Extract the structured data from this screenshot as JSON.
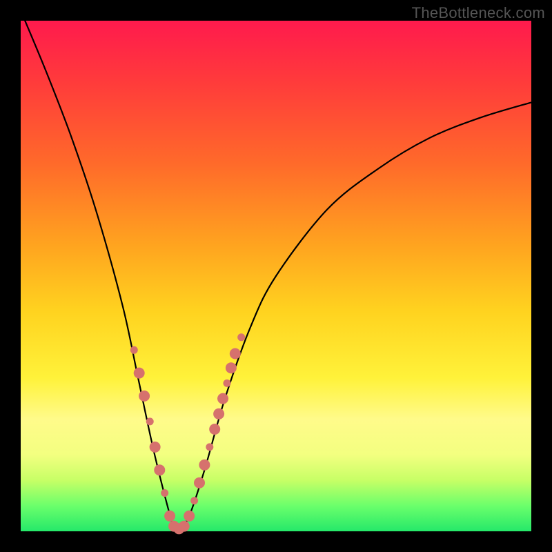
{
  "watermark": "TheBottleneck.com",
  "chart_data": {
    "type": "line",
    "title": "",
    "xlabel": "",
    "ylabel": "",
    "xlim": [
      0,
      100
    ],
    "ylim": [
      0,
      100
    ],
    "series": [
      {
        "name": "bottleneck-curve",
        "x": [
          0,
          5,
          10,
          15,
          20,
          23,
          26,
          29,
          30,
          31,
          33,
          36,
          40,
          45,
          50,
          60,
          70,
          80,
          90,
          100
        ],
        "values": [
          102,
          90,
          77,
          62,
          44,
          30,
          16,
          4,
          1,
          0.5,
          3,
          12,
          26,
          40,
          50,
          63,
          71,
          77,
          81,
          84
        ]
      }
    ],
    "markers": {
      "name": "highlight-points",
      "color": "#d6716d",
      "radius_small": 5.5,
      "radius_large": 8,
      "points": [
        {
          "x": 22.2,
          "y": 35.5,
          "r": "small"
        },
        {
          "x": 23.2,
          "y": 31.0,
          "r": "large"
        },
        {
          "x": 24.2,
          "y": 26.5,
          "r": "large"
        },
        {
          "x": 25.3,
          "y": 21.5,
          "r": "small"
        },
        {
          "x": 26.3,
          "y": 16.5,
          "r": "large"
        },
        {
          "x": 27.2,
          "y": 12.0,
          "r": "large"
        },
        {
          "x": 28.2,
          "y": 7.5,
          "r": "small"
        },
        {
          "x": 29.2,
          "y": 3.0,
          "r": "large"
        },
        {
          "x": 30.0,
          "y": 1.0,
          "r": "large"
        },
        {
          "x": 31.0,
          "y": 0.5,
          "r": "large"
        },
        {
          "x": 32.0,
          "y": 1.0,
          "r": "large"
        },
        {
          "x": 33.0,
          "y": 3.0,
          "r": "large"
        },
        {
          "x": 34.0,
          "y": 6.0,
          "r": "small"
        },
        {
          "x": 35.0,
          "y": 9.5,
          "r": "large"
        },
        {
          "x": 36.0,
          "y": 13.0,
          "r": "large"
        },
        {
          "x": 37.0,
          "y": 16.5,
          "r": "small"
        },
        {
          "x": 38.0,
          "y": 20.0,
          "r": "large"
        },
        {
          "x": 38.8,
          "y": 23.0,
          "r": "large"
        },
        {
          "x": 39.6,
          "y": 26.0,
          "r": "large"
        },
        {
          "x": 40.4,
          "y": 29.0,
          "r": "small"
        },
        {
          "x": 41.2,
          "y": 32.0,
          "r": "large"
        },
        {
          "x": 42.0,
          "y": 34.8,
          "r": "large"
        },
        {
          "x": 43.2,
          "y": 38.0,
          "r": "small"
        }
      ]
    }
  }
}
